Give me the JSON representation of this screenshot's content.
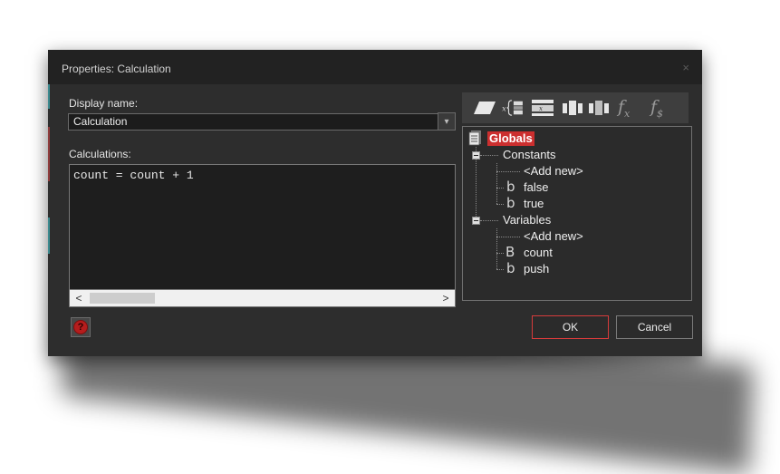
{
  "dialog": {
    "title": "Properties: Calculation",
    "close_glyph": "×"
  },
  "display_name": {
    "label": "Display name:",
    "value": "Calculation",
    "dropdown_glyph": "▾"
  },
  "calculations": {
    "label": "Calculations:",
    "code": "count = count + 1",
    "scroll_left": "<",
    "scroll_right": ">"
  },
  "toolbar": {
    "fx_label": "f",
    "fx_sub": "x",
    "fs_label": "f",
    "fs_sub": "$",
    "icons": [
      "parallelogram-icon",
      "variable-brace-icon",
      "expression-icon",
      "column-icon",
      "dots-column-icon",
      "function-icon",
      "string-function-icon"
    ]
  },
  "tree": {
    "root": "Globals",
    "constants": {
      "label": "Constants",
      "items": [
        "<Add new>",
        "false",
        "true"
      ]
    },
    "variables": {
      "label": "Variables",
      "items": [
        "<Add new>",
        "count",
        "push"
      ]
    },
    "glyph_bool": "b",
    "glyph_number": "B"
  },
  "buttons": {
    "help": "?",
    "ok": "OK",
    "cancel": "Cancel"
  },
  "colors": {
    "dialog_bg": "#2d2d2d",
    "titlebar_bg": "#222222",
    "accent_red": "#cc2f2f",
    "accent_teal": "#3c8a8f"
  }
}
